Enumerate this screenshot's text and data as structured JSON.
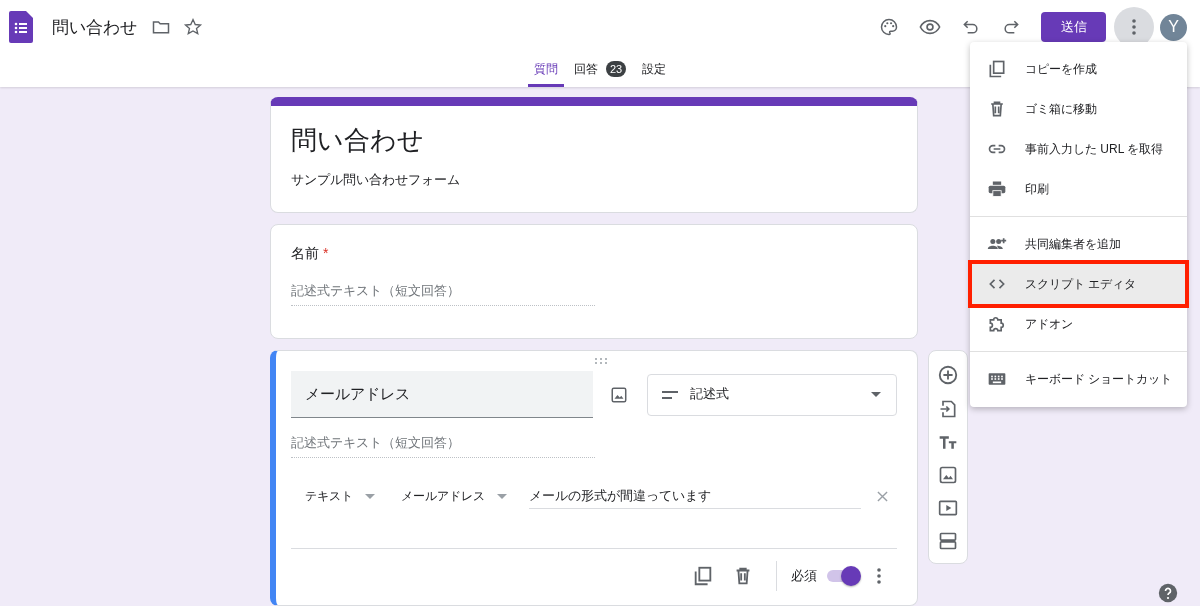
{
  "app": {
    "title": "問い合わせ"
  },
  "toolbar": {
    "send_button": "送信",
    "avatar": "Y"
  },
  "tabs": [
    {
      "label": "質問",
      "selected": true
    },
    {
      "label": "回答",
      "selected": false,
      "badge": "23"
    },
    {
      "label": "設定",
      "selected": false
    }
  ],
  "form": {
    "title": "問い合わせ",
    "description": "サンプル問い合わせフォーム"
  },
  "questions": [
    {
      "title": "名前",
      "required": true,
      "required_mark": "*",
      "active": false,
      "answer_hint": "記述式テキスト（短文回答）"
    },
    {
      "title": "メールアドレス",
      "required": true,
      "active": true,
      "type": "記述式",
      "answer_hint": "記述式テキスト（短文回答）",
      "validation": {
        "category": "テキスト",
        "rule": "メールアドレス",
        "error_message": "メールの形式が間違っています"
      },
      "required_label": "必須"
    }
  ],
  "menu": {
    "groups": [
      [
        {
          "kind": "copy",
          "label": "コピーを作成",
          "highlighted": false
        },
        {
          "kind": "trash",
          "label": "ゴミ箱に移動",
          "highlighted": false
        },
        {
          "kind": "link",
          "label": "事前入力した URL を取得",
          "highlighted": false
        },
        {
          "kind": "print",
          "label": "印刷",
          "highlighted": false
        }
      ],
      [
        {
          "kind": "collaborators",
          "label": "共同編集者を追加",
          "highlighted": false
        },
        {
          "kind": "code",
          "label": "スクリプト エディタ",
          "highlighted": true
        },
        {
          "kind": "addon",
          "label": "アドオン",
          "highlighted": false
        }
      ],
      [
        {
          "kind": "keyboard",
          "label": "キーボード ショートカット",
          "highlighted": false
        }
      ]
    ]
  }
}
